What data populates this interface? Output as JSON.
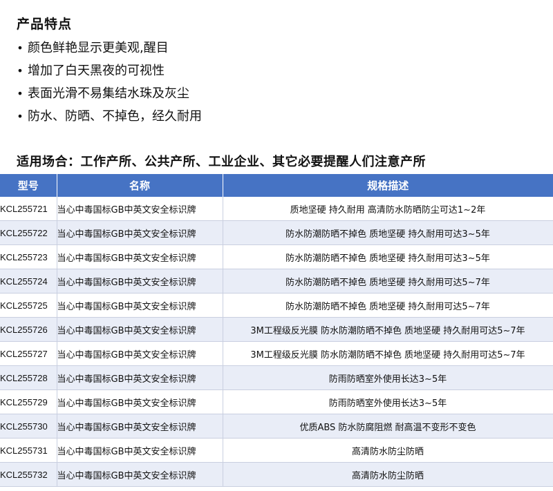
{
  "features": {
    "title": "产品特点",
    "items": [
      "颜色鲜艳显示更美观,醒目",
      "增加了白天黑夜的可视性",
      "表面光滑不易集结水珠及灰尘",
      "防水、防晒、不掉色，经久耐用"
    ]
  },
  "usage": "适用场合：工作产所、公共产所、工业企业、其它必要提醒人们注意产所",
  "table": {
    "headers": [
      "型号",
      "名称",
      "规格描述"
    ],
    "rows": [
      {
        "model": "KCL255721",
        "name": "当心中毒国标GB中英文安全标识牌",
        "desc": "质地坚硬 持久耐用 高清防水防晒防尘可达1~2年"
      },
      {
        "model": "KCL255722",
        "name": "当心中毒国标GB中英文安全标识牌",
        "desc": "防水防潮防晒不掉色 质地坚硬 持久耐用可达3~5年"
      },
      {
        "model": "KCL255723",
        "name": "当心中毒国标GB中英文安全标识牌",
        "desc": "防水防潮防晒不掉色 质地坚硬 持久耐用可达3~5年"
      },
      {
        "model": "KCL255724",
        "name": "当心中毒国标GB中英文安全标识牌",
        "desc": "防水防潮防晒不掉色 质地坚硬 持久耐用可达5~7年"
      },
      {
        "model": "KCL255725",
        "name": "当心中毒国标GB中英文安全标识牌",
        "desc": "防水防潮防晒不掉色 质地坚硬 持久耐用可达5~7年"
      },
      {
        "model": "KCL255726",
        "name": "当心中毒国标GB中英文安全标识牌",
        "desc": "3M工程级反光膜 防水防潮防晒不掉色 质地坚硬 持久耐用可达5~7年"
      },
      {
        "model": "KCL255727",
        "name": "当心中毒国标GB中英文安全标识牌",
        "desc": "3M工程级反光膜 防水防潮防晒不掉色 质地坚硬 持久耐用可达5~7年"
      },
      {
        "model": "KCL255728",
        "name": "当心中毒国标GB中英文安全标识牌",
        "desc": "防雨防晒室外使用长达3~5年"
      },
      {
        "model": "KCL255729",
        "name": "当心中毒国标GB中英文安全标识牌",
        "desc": "防雨防晒室外使用长达3~5年"
      },
      {
        "model": "KCL255730",
        "name": "当心中毒国标GB中英文安全标识牌",
        "desc": "优质ABS 防水防腐阻燃 耐高温不变形不变色"
      },
      {
        "model": "KCL255731",
        "name": "当心中毒国标GB中英文安全标识牌",
        "desc": "高清防水防尘防晒"
      },
      {
        "model": "KCL255732",
        "name": "当心中毒国标GB中英文安全标识牌",
        "desc": "高清防水防尘防晒"
      }
    ]
  },
  "colors": {
    "header_bg": "#4673c4",
    "row_alt_bg": "#e9edf7"
  }
}
